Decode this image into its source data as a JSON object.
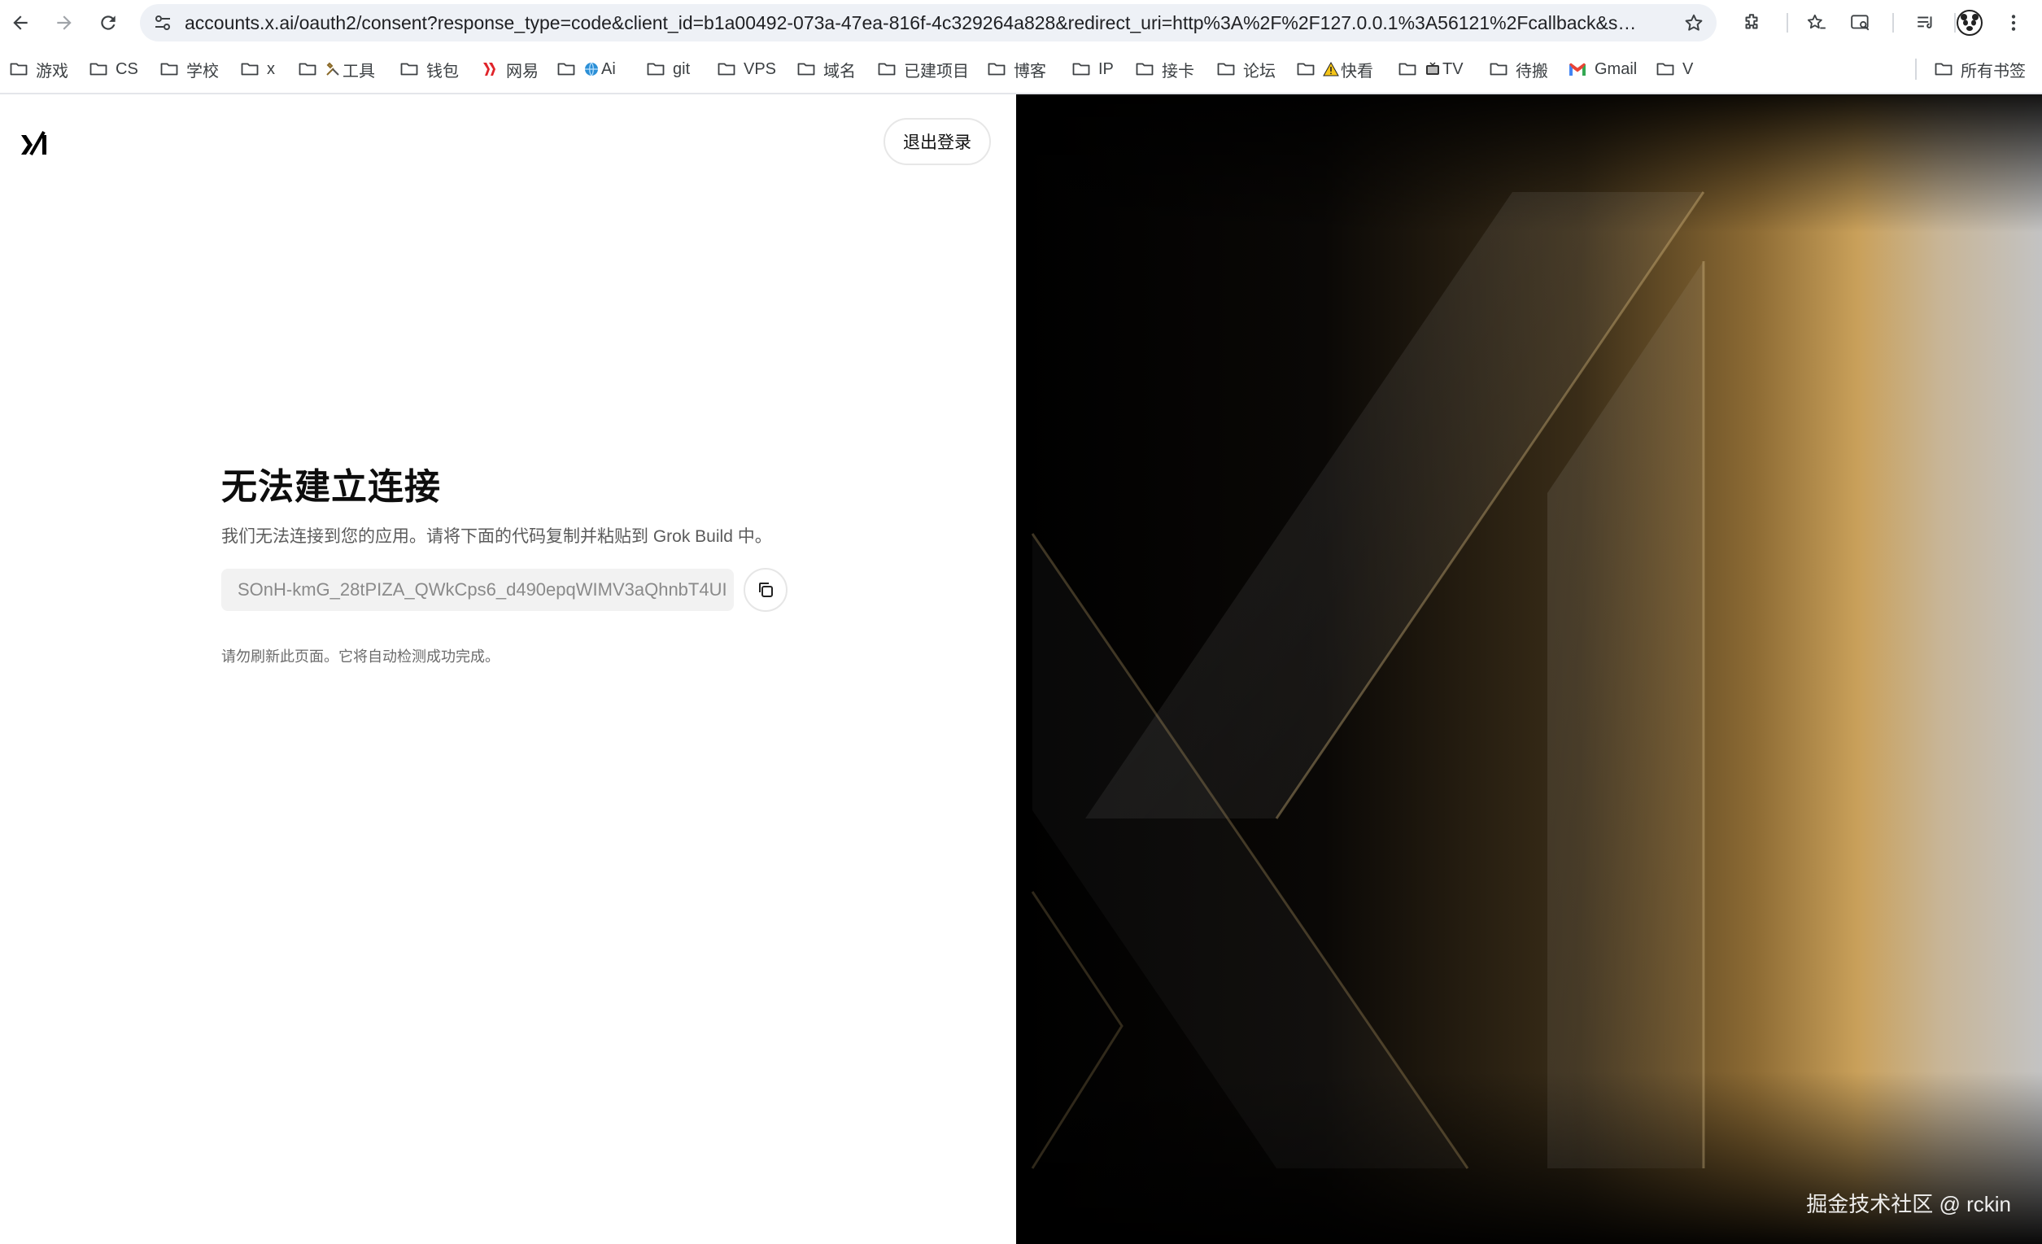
{
  "browser": {
    "url": "accounts.x.ai/oauth2/consent?response_type=code&client_id=b1a00492-073a-47ea-816f-4c329264a828&redirect_uri=http%3A%2F%2F127.0.0.1%3A56121%2Fcallback&scope=o..."
  },
  "bookmarks": [
    {
      "label": "游戏",
      "icon": "folder-icon"
    },
    {
      "label": "CS",
      "icon": "folder-icon"
    },
    {
      "label": "学校",
      "icon": "folder-icon"
    },
    {
      "label": "x",
      "icon": "folder-icon"
    },
    {
      "label": "工具",
      "icon": "folder-icon"
    },
    {
      "label": "钱包",
      "icon": "folder-icon"
    },
    {
      "label": "网易",
      "icon": "netease-icon"
    },
    {
      "label": "Ai",
      "icon": "folder-icon"
    },
    {
      "label": "git",
      "icon": "folder-icon"
    },
    {
      "label": "VPS",
      "icon": "folder-icon"
    },
    {
      "label": "域名",
      "icon": "folder-icon"
    },
    {
      "label": "已建项目",
      "icon": "folder-icon"
    },
    {
      "label": "博客",
      "icon": "folder-icon"
    },
    {
      "label": "IP",
      "icon": "folder-icon"
    },
    {
      "label": "接卡",
      "icon": "folder-icon"
    },
    {
      "label": "论坛",
      "icon": "folder-icon"
    },
    {
      "label": "快看",
      "icon": "folder-icon"
    },
    {
      "label": "TV",
      "icon": "folder-icon"
    },
    {
      "label": "待搬",
      "icon": "folder-icon"
    },
    {
      "label": "Gmail",
      "icon": "gmail-icon"
    },
    {
      "label": "V",
      "icon": "folder-icon"
    }
  ],
  "all_bookmarks": "所有书签",
  "page": {
    "logout": "退出登录",
    "title": "无法建立连接",
    "description": "我们无法连接到您的应用。请将下面的代码复制并粘贴到 Grok Build 中。",
    "code": "SOnH-kmG_28tPIZA_QWkCps6_d490epqWIMV3aQhnbT4UI",
    "hint": "请勿刷新此页面。它将自动检测成功完成。"
  },
  "watermark": "掘金技术社区 @ rckin",
  "colors": {
    "accent_gold": "#c9a05a",
    "code_bg": "#f2f2f2"
  }
}
